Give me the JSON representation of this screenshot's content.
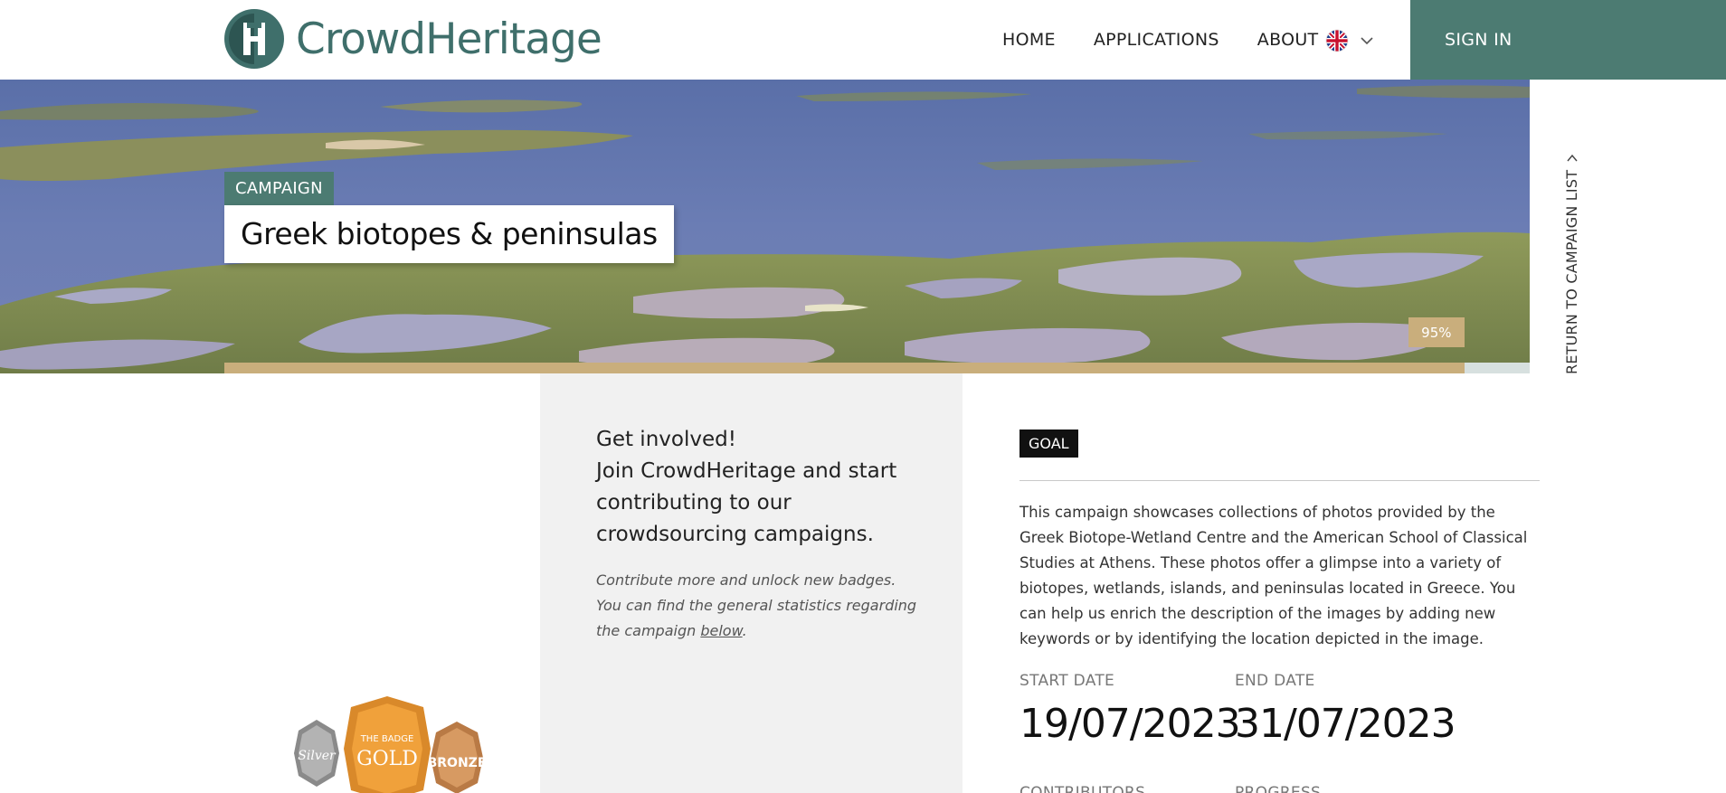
{
  "header": {
    "logo_text": "CrowdHeritage",
    "nav": [
      "HOME",
      "APPLICATIONS",
      "ABOUT"
    ],
    "language_icon": "uk-flag-icon",
    "signin_label": "SIGN IN"
  },
  "hero": {
    "tag": "CAMPAIGN",
    "title": "Greek biotopes & peninsulas",
    "progress_percent": 95,
    "progress_label": "95%",
    "return_label": "RETURN TO CAMPAIGN LIST"
  },
  "panel": {
    "heading": "Get involved!\nJoin CrowdHeritage and start contributing to our crowdsourcing campaigns.",
    "heading_line1": "Get involved!",
    "heading_line2": "Join CrowdHeritage and start contributing to our crowdsourcing campaigns.",
    "note_line1": "Contribute more and unlock new badges.",
    "note_line2": "You can find the general statistics regarding the campaign ",
    "note_link": "below",
    "note_end": "."
  },
  "goal": {
    "tag": "GOAL",
    "description": "This campaign showcases collections of photos provided by the Greek Biotope-Wetland Centre and the American School of Classical Studies at Athens. These photos offer a glimpse into a variety of biotopes, wetlands, islands, and peninsulas located in Greece. You can help us enrich the description of the images by adding new keywords or by identifying the location depicted in the image.",
    "start_label": "START DATE",
    "start_value": "19/07/2023",
    "end_label": "END DATE",
    "end_value": "31/07/2023",
    "contributors_label": "CONTRIBUTORS",
    "progress_label": "PROGRESS"
  },
  "badges": {
    "silver": "Silver",
    "gold_top": "THE BADGE",
    "gold": "GOLD",
    "bronze": "BRONZE"
  },
  "colors": {
    "brand": "#4c7b72",
    "progress": "#c9ae7c",
    "panel": "#f1f1f1"
  }
}
